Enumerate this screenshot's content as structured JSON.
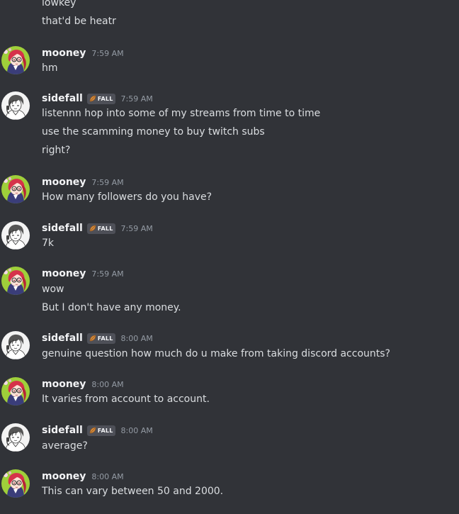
{
  "continuation_messages": [
    "lowkey",
    "that'd be heatr"
  ],
  "messages": [
    {
      "author": "mooney",
      "avatar": "mooney-avatar",
      "time": "7:59 AM",
      "lines": [
        "hm"
      ]
    },
    {
      "author": "sidefall",
      "avatar": "sidefall-avatar",
      "tag": "FALL",
      "time": "7:59 AM",
      "lines": [
        "listennn hop into some of my streams from time to time",
        "use the scamming money to buy twitch subs",
        "right?"
      ]
    },
    {
      "author": "mooney",
      "avatar": "mooney-avatar",
      "time": "7:59 AM",
      "lines": [
        "How many followers do you have?"
      ]
    },
    {
      "author": "sidefall",
      "avatar": "sidefall-avatar",
      "tag": "FALL",
      "time": "7:59 AM",
      "lines": [
        "7k"
      ]
    },
    {
      "author": "mooney",
      "avatar": "mooney-avatar",
      "time": "7:59 AM",
      "lines": [
        "wow",
        "But I don't have any money."
      ]
    },
    {
      "author": "sidefall",
      "avatar": "sidefall-avatar",
      "tag": "FALL",
      "time": "8:00 AM",
      "lines": [
        "genuine question how much do u make from taking discord accounts?"
      ]
    },
    {
      "author": "mooney",
      "avatar": "mooney-avatar",
      "time": "8:00 AM",
      "lines": [
        "It varies from account to account."
      ]
    },
    {
      "author": "sidefall",
      "avatar": "sidefall-avatar",
      "tag": "FALL",
      "time": "8:00 AM",
      "lines": [
        "average?"
      ]
    },
    {
      "author": "mooney",
      "avatar": "mooney-avatar",
      "time": "8:00 AM",
      "lines": [
        "This can vary between 50 and 2000."
      ]
    }
  ],
  "colors": {
    "background": "#313338",
    "text": "#dbdee1",
    "username": "#f2f3f5",
    "timestamp": "#949ba4",
    "tag_bg": "#4e5058"
  }
}
